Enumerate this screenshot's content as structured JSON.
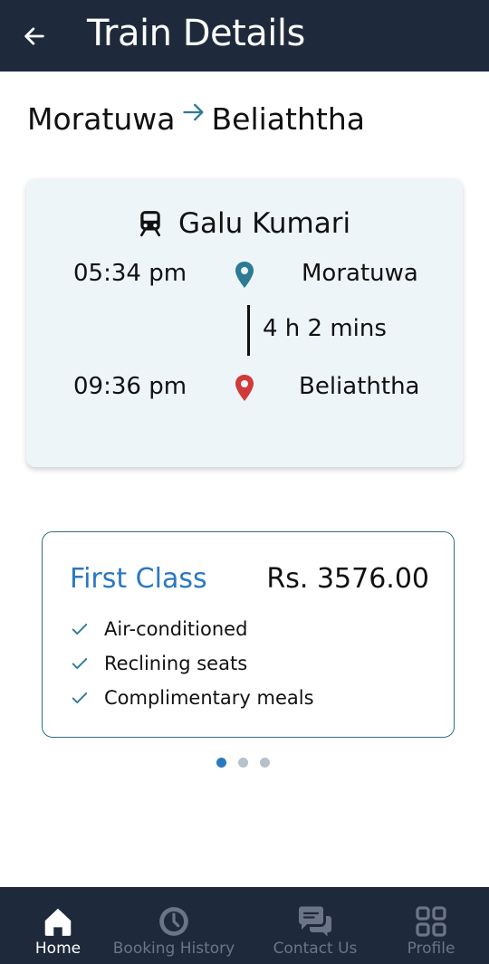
{
  "header": {
    "title": "Train Details",
    "back_icon": "arrow-left-icon"
  },
  "route": {
    "from": "Moratuwa",
    "to": "Beliaththa"
  },
  "train": {
    "name": "Galu Kumari",
    "departure_time": "05:34 pm",
    "departure_station": "Moratuwa",
    "duration": "4 h 2 mins",
    "arrival_time": "09:36 pm",
    "arrival_station": "Beliaththa"
  },
  "ticket_class": {
    "name": "First Class",
    "price": "Rs. 3576.00",
    "features": [
      "Air-conditioned",
      "Reclining seats",
      "Complimentary meals"
    ]
  },
  "carousel": {
    "count": 3,
    "active_index": 0
  },
  "bottom_nav": {
    "items": [
      {
        "label": "Home",
        "icon": "home-icon",
        "active": true
      },
      {
        "label": "Booking History",
        "icon": "clock-icon",
        "active": false
      },
      {
        "label": "Contact Us",
        "icon": "chat-icon",
        "active": false
      },
      {
        "label": "Profile",
        "icon": "grid-icon",
        "active": false
      }
    ]
  },
  "colors": {
    "header_bg": "#1e2a3c",
    "accent_blue": "#2b78c0",
    "pin_origin": "#2d7a96",
    "pin_destination": "#d23a3a",
    "card_bg": "#eef5f9",
    "card_border": "#2e6f87"
  }
}
